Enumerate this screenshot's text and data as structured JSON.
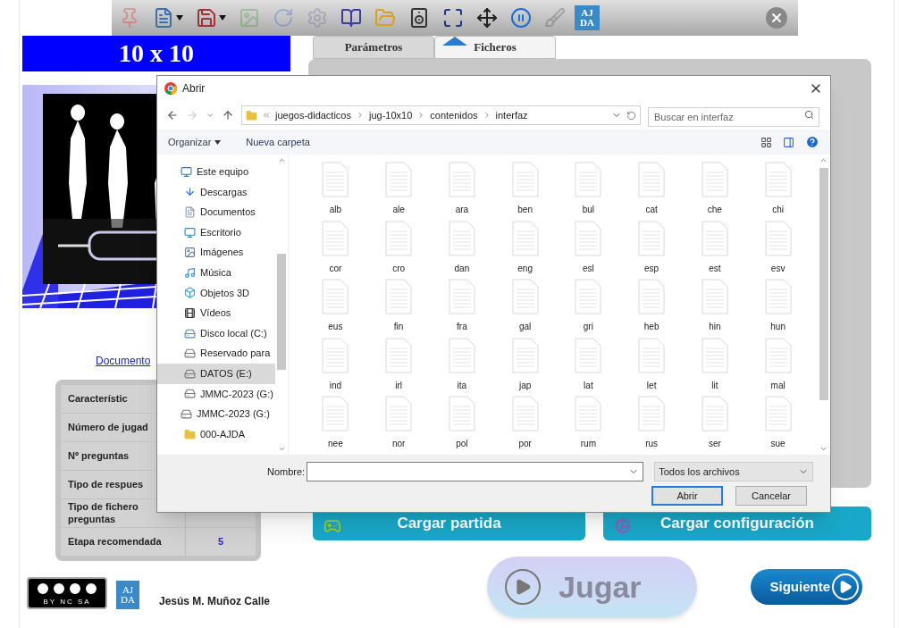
{
  "toolbar": [
    {
      "kind": "pin",
      "disabled": true
    },
    {
      "kind": "document",
      "disabled": false
    },
    {
      "kind": "disk",
      "disabled": false
    },
    {
      "kind": "landscape",
      "disabled": true
    },
    {
      "kind": "reload",
      "disabled": true
    },
    {
      "kind": "gear",
      "disabled": true
    },
    {
      "kind": "book",
      "disabled": false
    },
    {
      "kind": "folder",
      "disabled": false
    },
    {
      "kind": "speaker",
      "disabled": false
    },
    {
      "kind": "fullscreen",
      "disabled": false
    },
    {
      "kind": "move",
      "disabled": false
    },
    {
      "kind": "pause",
      "disabled": false
    },
    {
      "kind": "brush",
      "disabled": true
    },
    {
      "kind": "logo",
      "disabled": false,
      "lines": [
        "AJ",
        "DA"
      ]
    },
    {
      "kind": "close",
      "disabled": false
    }
  ],
  "title": "10 x 10",
  "doc_link": "Documento",
  "features": [
    {
      "label": "Característic"
    },
    {
      "label": "Número de jugad"
    },
    {
      "label": "Nº preguntas"
    },
    {
      "label": "Tipo de respues"
    },
    {
      "label": "Tipo de fichero preguntas"
    },
    {
      "label": "Etapa recomendada",
      "value": "5"
    }
  ],
  "footer": {
    "license": "BY NC SA",
    "logo_lines": [
      "AJ",
      "DA"
    ],
    "author": "Jesús M. Muñoz Calle"
  },
  "tabs": [
    {
      "label": "Parámetros",
      "selected": false
    },
    {
      "label": "Ficheros",
      "selected": true
    }
  ],
  "load_buttons": [
    {
      "label": "Cargar partida",
      "kind": "game"
    },
    {
      "label": "Cargar configuración",
      "kind": "config"
    }
  ],
  "play_button": {
    "label": "Jugar",
    "disabled": true
  },
  "next_button": {
    "label": "Siguiente",
    "disabled": false
  },
  "dialog": {
    "title": "Abrir",
    "path": [
      "juegos-didacticos",
      "jug-10x10",
      "contenidos",
      "interfaz"
    ],
    "search": {
      "placeholder": "Buscar en interfaz"
    },
    "commands": [
      "Organizar",
      "Nueva carpeta"
    ],
    "nav": [
      {
        "label": "Este equipo",
        "kind": "computer",
        "selected": false,
        "children": [
          {
            "label": "Descargas",
            "kind": "download",
            "selected": false
          },
          {
            "label": "Documentos",
            "kind": "documents",
            "selected": false
          },
          {
            "label": "Escritorio",
            "kind": "desktop",
            "selected": false
          },
          {
            "label": "Imágenes",
            "kind": "images",
            "selected": false
          },
          {
            "label": "Música",
            "kind": "music",
            "selected": false
          },
          {
            "label": "Objetos 3D",
            "kind": "objects",
            "selected": false
          },
          {
            "label": "Vídeos",
            "kind": "videos",
            "selected": false
          },
          {
            "label": "Disco local (C:)",
            "kind": "disk",
            "selected": false
          },
          {
            "label": "Reservado para",
            "kind": "drive",
            "selected": false
          },
          {
            "label": "DATOS (E:)",
            "kind": "drive",
            "selected": true
          },
          {
            "label": "JMMC-2023 (G:)",
            "kind": "drive",
            "selected": false
          }
        ]
      },
      {
        "label": "JMMC-2023 (G:)",
        "kind": "drive",
        "selected": false,
        "children": [
          {
            "label": "000-AJDA",
            "kind": "folder",
            "selected": false
          }
        ]
      }
    ],
    "files": [
      "alb",
      "ale",
      "ara",
      "ben",
      "bul",
      "cat",
      "che",
      "chi",
      "cor",
      "cro",
      "dan",
      "eng",
      "esl",
      "esp",
      "est",
      "esv",
      "eus",
      "fin",
      "fra",
      "gal",
      "gri",
      "heb",
      "hin",
      "hun",
      "ind",
      "irl",
      "ita",
      "jap",
      "lat",
      "let",
      "lit",
      "mal",
      "nee",
      "nor",
      "pol",
      "por",
      "rum",
      "rus",
      "ser",
      "sue"
    ],
    "name_label": "Nombre:",
    "file_type": "Todos los archivos",
    "buttons": [
      "Abrir",
      "Cancelar"
    ]
  }
}
